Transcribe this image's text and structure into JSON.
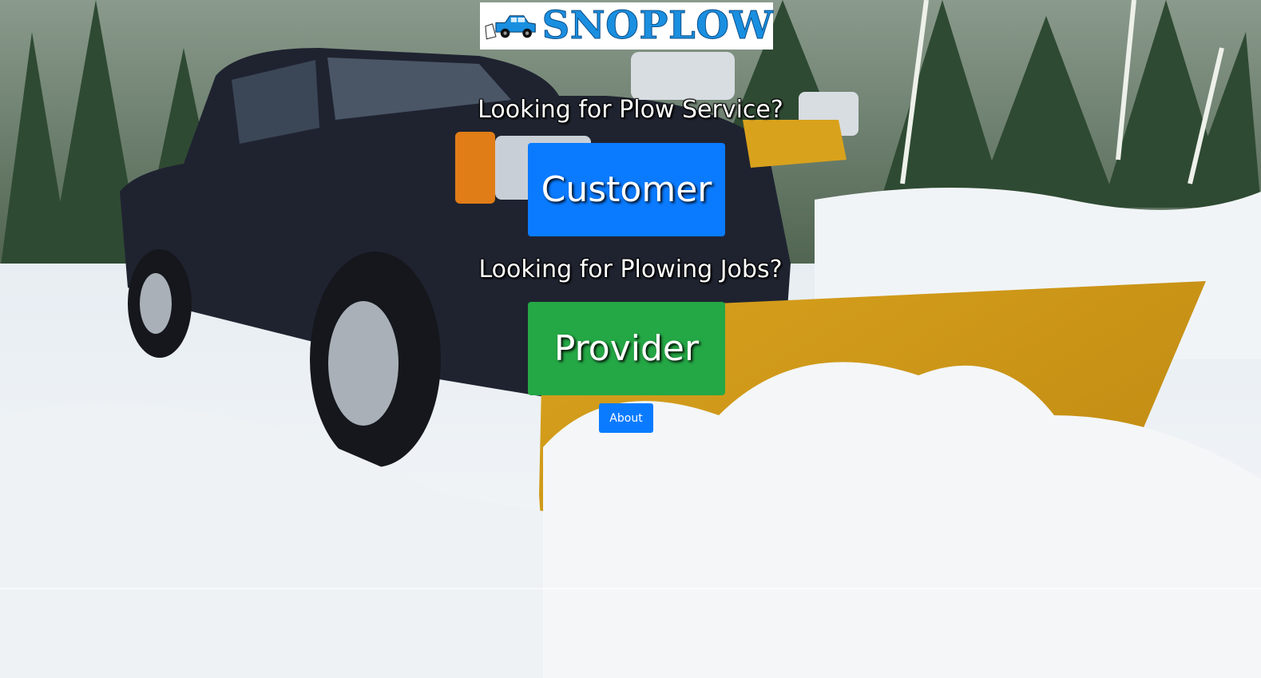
{
  "logo": {
    "text": "SNOPLOW",
    "icon": "plow-truck-icon",
    "text_color": "#1a8fe0"
  },
  "customer_section": {
    "heading": "Looking for Plow Service?",
    "button_label": "Customer",
    "button_color": "#0a7bff"
  },
  "provider_section": {
    "heading": "Looking for Plowing Jobs?",
    "button_label": "Provider",
    "button_color": "#24a745"
  },
  "about": {
    "button_label": "About",
    "button_color": "#0a7bff"
  },
  "background": {
    "scene": "snow-plow-truck-photo"
  }
}
